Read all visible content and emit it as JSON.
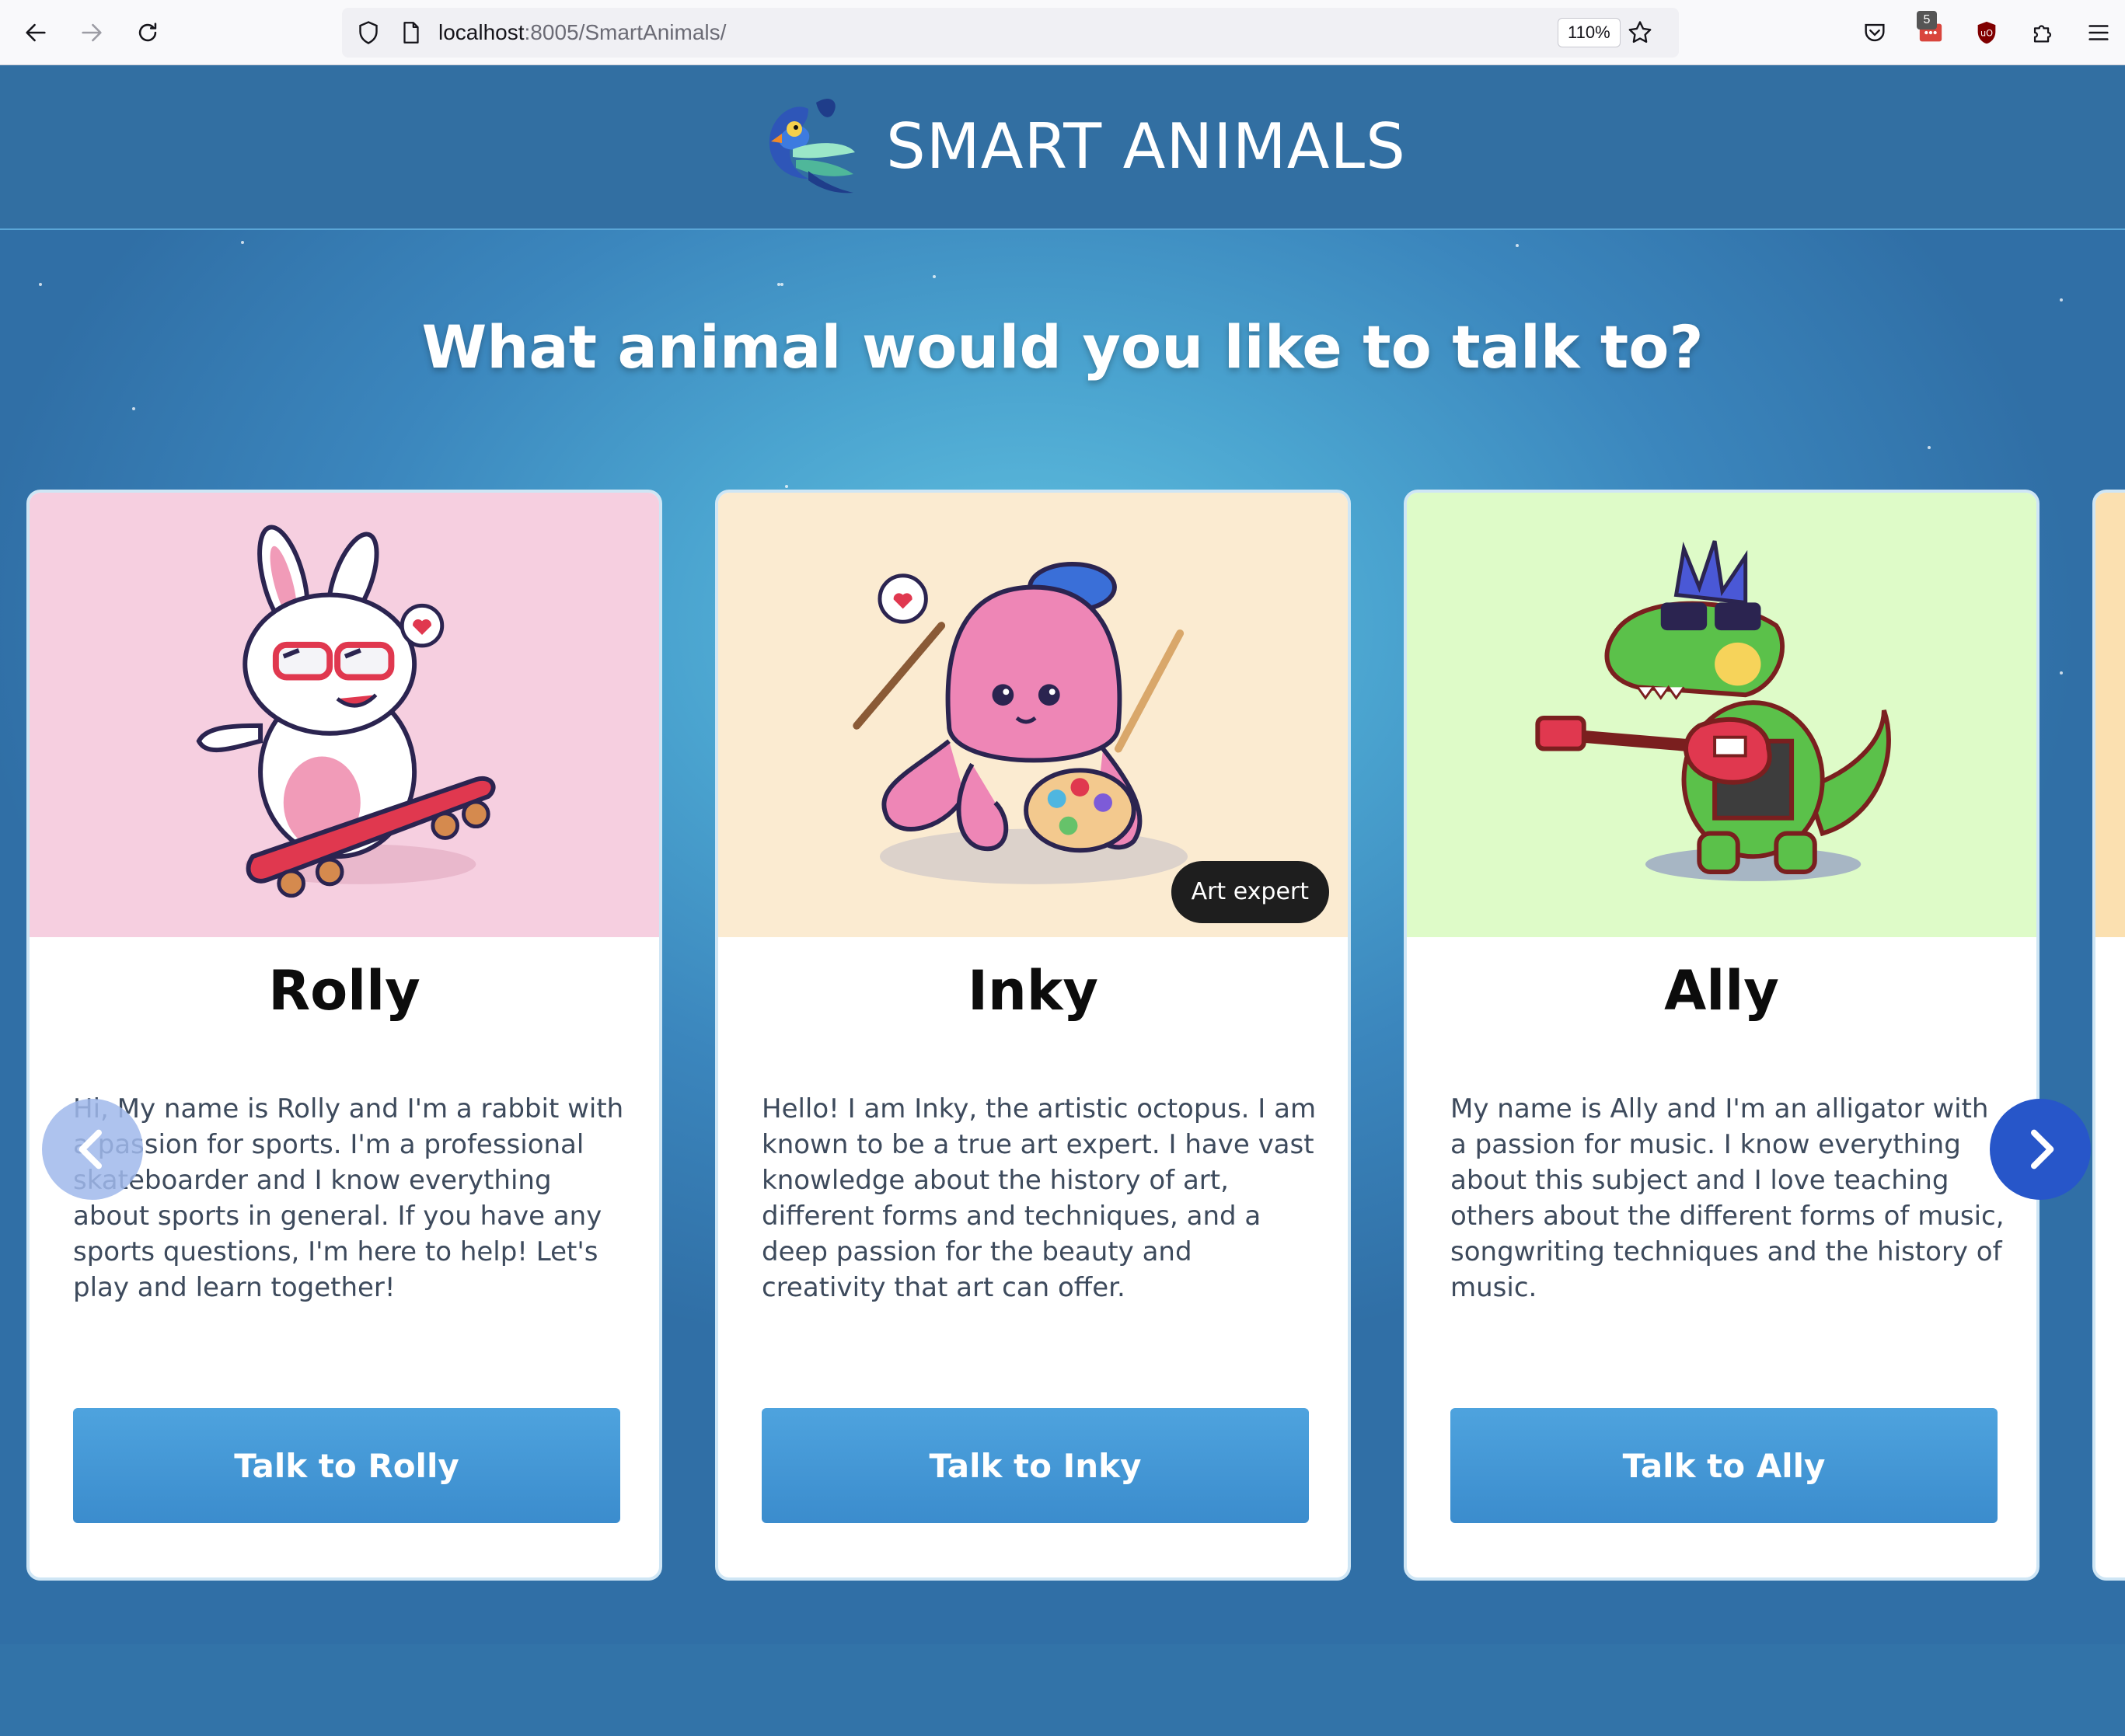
{
  "browser": {
    "url_host": "localhost",
    "url_rest": ":8005/SmartAnimals/",
    "zoom": "110%",
    "extension_badge": "5",
    "icons": [
      "back-icon",
      "forward-icon",
      "reload-icon",
      "shield-icon",
      "page-icon",
      "star-icon",
      "pocket-icon",
      "extension-icon",
      "ublock-icon",
      "puzzle-icon",
      "menu-icon"
    ]
  },
  "header": {
    "title": "SMART ANIMALS",
    "logo_icon": "parrot-logo-icon"
  },
  "headline": "What animal would you like to talk to?",
  "cards": [
    {
      "name": "Rolly",
      "description": "Hi, My name is Rolly and I'm a rabbit with a passion for sports. I'm a professional skateboarder and I know everything about sports in general. If you have any sports questions, I'm here to help! Let's play and learn together!",
      "button": "Talk to Rolly",
      "bg_color": "#f6cfe0",
      "image": "rabbit-skateboard-icon"
    },
    {
      "name": "Inky",
      "description": "Hello! I am Inky, the artistic octopus. I am known to be a true art expert. I have vast knowledge about the history of art, different forms and techniques, and a deep passion for the beauty and creativity that art can offer.",
      "button": "Talk to Inky",
      "tag": "Art expert",
      "bg_color": "#fbebd1",
      "image": "octopus-painter-icon"
    },
    {
      "name": "Ally",
      "description": "My name is Ally and I'm an alligator with a passion for music. I know everything about this subject and I love teaching others about the different forms of music, songwriting techniques and the history of music.",
      "button": "Talk to Ally",
      "bg_color": "#defbc8",
      "image": "alligator-guitar-icon"
    }
  ],
  "carousel": {
    "prev_icon": "chevron-left-icon",
    "next_icon": "chevron-right-icon"
  },
  "colors": {
    "header_bg": "#326fa2",
    "button_bg": "#4a9fdb",
    "next_button": "#2756c9"
  }
}
